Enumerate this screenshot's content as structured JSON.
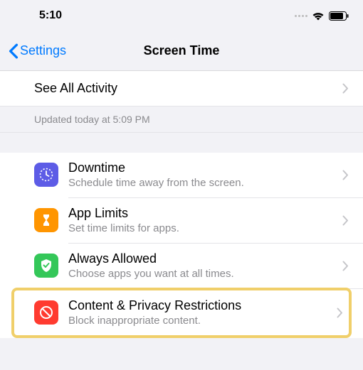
{
  "status": {
    "time": "5:10"
  },
  "nav": {
    "back": "Settings",
    "title": "Screen Time"
  },
  "see_all": {
    "label": "See All Activity"
  },
  "updated": {
    "text": "Updated today at 5:09 PM"
  },
  "rows": {
    "downtime": {
      "title": "Downtime",
      "sub": "Schedule time away from the screen."
    },
    "app_limits": {
      "title": "App Limits",
      "sub": "Set time limits for apps."
    },
    "always_allowed": {
      "title": "Always Allowed",
      "sub": "Choose apps you want at all times."
    },
    "content_privacy": {
      "title": "Content & Privacy Restrictions",
      "sub": "Block inappropriate content."
    }
  },
  "colors": {
    "downtime": "#5d5ce6",
    "app_limits": "#ff9500",
    "always_allowed": "#34c759",
    "content_privacy": "#ff3b30"
  }
}
